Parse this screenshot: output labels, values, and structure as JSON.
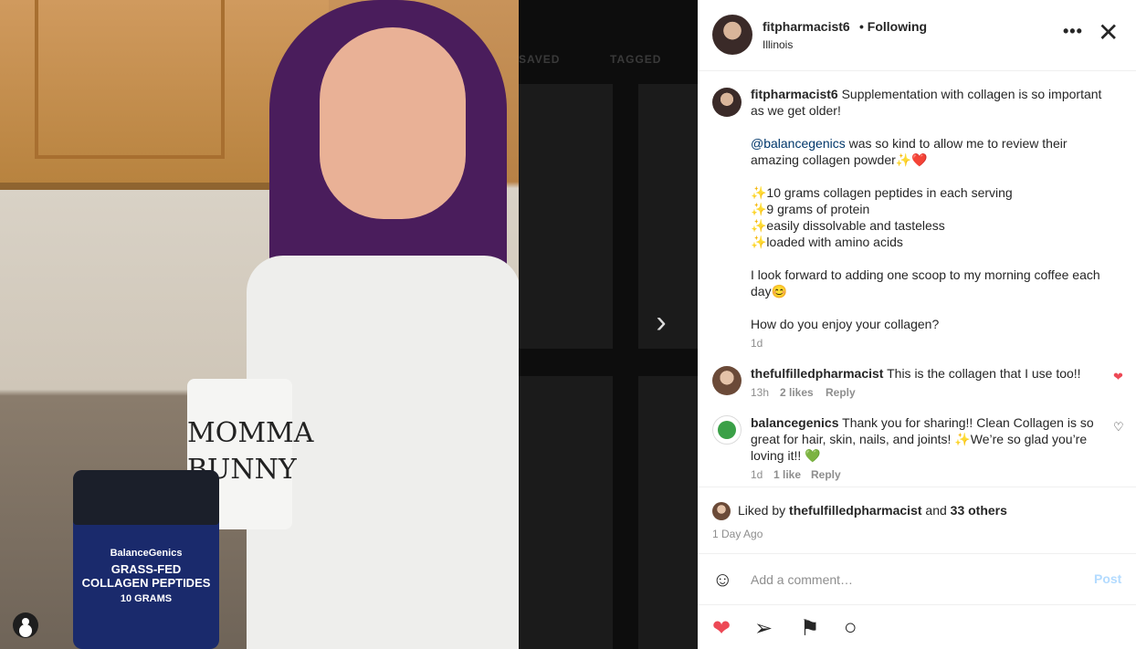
{
  "photo": {
    "mug_text": "MOMMA\nBUNNY",
    "product_brand": "BalanceGenics",
    "product_name": "GRASS-FED COLLAGEN PEPTIDES",
    "product_sub": "10 GRAMS"
  },
  "background": {
    "tab_saved": "SAVED",
    "tab_tagged": "TAGGED"
  },
  "header": {
    "username": "fitpharmacist6",
    "follow_status": "• Following",
    "location": "Illinois",
    "more_icon": "more-icon",
    "close_icon": "close-icon"
  },
  "caption": {
    "username": "fitpharmacist6",
    "line1": " Supplementation with collagen is so important as we get older!",
    "mention": "@balancegenics",
    "line2": " was so kind to allow me to review their amazing collagen powder✨❤️",
    "bullets": "✨10 grams collagen peptides in each serving\n✨9 grams of protein\n✨easily dissolvable and tasteless\n✨loaded with amino acids",
    "line3": "I look forward to adding one scoop to my morning coffee each day😊",
    "line4": "How do you enjoy your collagen?",
    "time": "1d"
  },
  "comments": [
    {
      "username": "thefulfilledpharmacist",
      "text": " This is the collagen that I use too!!",
      "time": "13h",
      "likes": "2 likes",
      "reply": "Reply",
      "liked": true
    },
    {
      "username": "balancegenics",
      "text": " Thank you for sharing!! Clean Collagen is so great for hair, skin, nails, and joints! ✨We’re so glad you’re loving it!! 💚",
      "time": "1d",
      "likes": "1 like",
      "reply": "Reply",
      "liked": false
    }
  ],
  "likes": {
    "prefix": "Liked by ",
    "by": "thefulfilledpharmacist",
    "and": " and ",
    "others": "33 others",
    "posted": "1 Day Ago"
  },
  "add_comment": {
    "placeholder": "Add a comment…",
    "post_label": "Post"
  },
  "colors": {
    "like_red": "#ed4956",
    "post_blue_disabled": "#b3dbff",
    "mention_blue": "#00376b"
  }
}
